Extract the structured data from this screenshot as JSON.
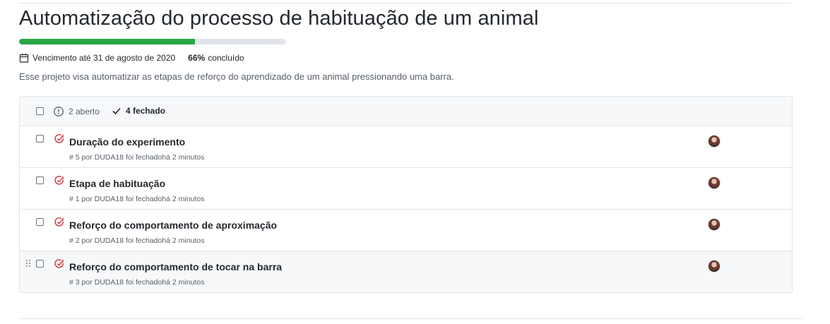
{
  "milestone": {
    "title": "Automatização do processo de habituação de um animal",
    "progress_fraction": 0.66,
    "due": "Vencimento até 31 de agosto de 2020",
    "percent": "66%",
    "percent_label": "concluído",
    "description": "Esse projeto visa automatizar as etapas de reforço do aprendizado de um animal pressionando uma barra."
  },
  "filters": {
    "open_label": "2 aberto",
    "closed_label": "4 fechado"
  },
  "issues": [
    {
      "title": "Duração do experimento",
      "meta": "# 5 por DUDA18 foi fechadohá 2 minutos"
    },
    {
      "title": "Etapa de habituação",
      "meta": "# 1 por DUDA18 foi fechadohá 2 minutos"
    },
    {
      "title": "Reforço do comportamento de aproximação",
      "meta": "# 2 por DUDA18 foi fechadohá 2 minutos"
    },
    {
      "title": "Reforço do comportamento de tocar na barra",
      "meta": "# 3 por DUDA18 foi fechadohá 2 minutos"
    }
  ],
  "colors": {
    "progress": "#28a745",
    "closed_icon": "#cb2431"
  },
  "icons": {
    "calendar": "calendar-icon",
    "open": "issue-opened-icon",
    "closed_check": "check-icon",
    "issue_closed": "issue-closed-icon",
    "drag": "grabber-icon"
  }
}
